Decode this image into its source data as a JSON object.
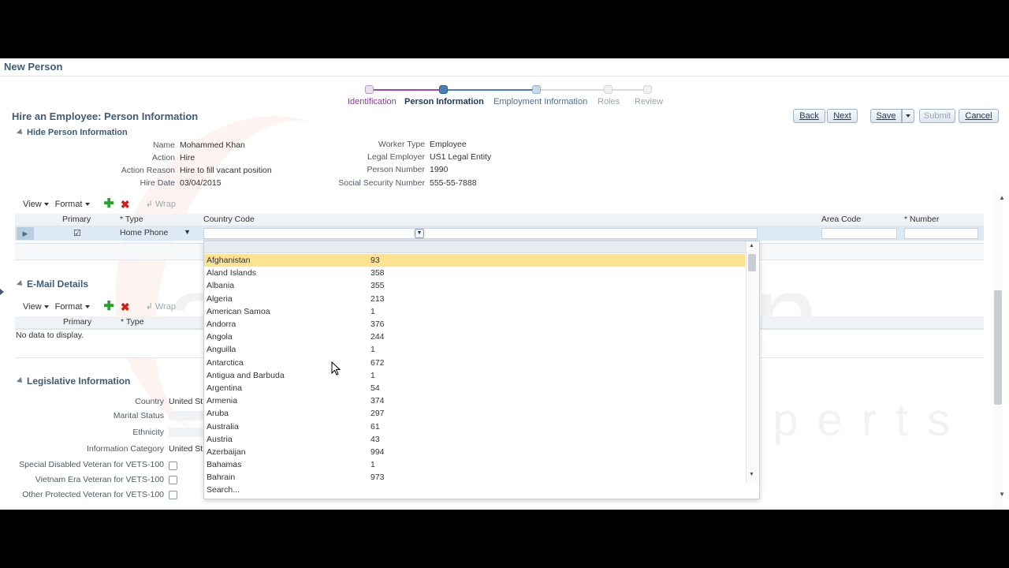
{
  "page": {
    "title": "New Person"
  },
  "train": [
    {
      "label": "Identification",
      "color": "#8a3d97",
      "node_bg": "#e8dff0",
      "node_border": "#b49ac8"
    },
    {
      "label": "Person Information",
      "color": "#203a5a",
      "node_bg": "#4a7fb5",
      "node_border": "#2e5f93"
    },
    {
      "label": "Employment Information",
      "color": "#4b6f93",
      "node_bg": "#c9d9ea",
      "node_border": "#8fb0d0"
    },
    {
      "label": "Roles",
      "color": "#9aa3ab",
      "node_bg": "#eef0f2",
      "node_border": "#d2d7dc"
    },
    {
      "label": "Review",
      "color": "#9aa3ab",
      "node_bg": "#eef0f2",
      "node_border": "#d2d7dc"
    }
  ],
  "header": {
    "title": "Hire an Employee: Person Information"
  },
  "buttons": {
    "back": "Back",
    "next": "Next",
    "save": "Save",
    "submit": "Submit",
    "cancel": "Cancel"
  },
  "person_info": {
    "toggle_label": "Hide Person Information",
    "left": [
      {
        "key": "Name",
        "value": "Mohammed Khan"
      },
      {
        "key": "Action",
        "value": "Hire"
      },
      {
        "key": "Action Reason",
        "value": "Hire to fill vacant position"
      },
      {
        "key": "Hire Date",
        "value": "03/04/2015"
      }
    ],
    "right": [
      {
        "key": "Worker Type",
        "value": "Employee"
      },
      {
        "key": "Legal Employer",
        "value": "US1 Legal Entity"
      },
      {
        "key": "Person Number",
        "value": "1990"
      },
      {
        "key": "Social Security Number",
        "value": "555-55-7888"
      }
    ]
  },
  "toolbar": {
    "view": "View",
    "format": "Format",
    "wrap": "Wrap"
  },
  "phone_grid": {
    "col_primary": "Primary",
    "col_type": "* Type",
    "col_country_code": "Country Code",
    "col_area_code": "Area Code",
    "col_number": "* Number",
    "row_type_value": "Home Phone"
  },
  "email": {
    "title": "E-Mail Details",
    "col_primary": "Primary",
    "col_type": "* Type",
    "empty_text": "No data to display."
  },
  "legislative": {
    "title": "Legislative Information",
    "fields": [
      {
        "key": "Country",
        "value": "United St"
      },
      {
        "key": "Marital Status",
        "value": ""
      },
      {
        "key": "Ethnicity",
        "value": ""
      },
      {
        "key": "Information Category",
        "value": "United St"
      }
    ],
    "checkboxes": [
      "Special Disabled Veteran for VETS-100",
      "Vietnam Era Veteran for VETS-100",
      "Other Protected Veteran for VETS-100"
    ]
  },
  "country_dropdown": {
    "items": [
      {
        "name": "Afghanistan",
        "code": "93"
      },
      {
        "name": "Aland Islands",
        "code": "358"
      },
      {
        "name": "Albania",
        "code": "355"
      },
      {
        "name": "Algeria",
        "code": "213"
      },
      {
        "name": "American Samoa",
        "code": "1"
      },
      {
        "name": "Andorra",
        "code": "376"
      },
      {
        "name": "Angola",
        "code": "244"
      },
      {
        "name": "Anguilla",
        "code": "1"
      },
      {
        "name": "Antarctica",
        "code": "672"
      },
      {
        "name": "Antigua and Barbuda",
        "code": "1"
      },
      {
        "name": "Argentina",
        "code": "54"
      },
      {
        "name": "Armenia",
        "code": "374"
      },
      {
        "name": "Aruba",
        "code": "297"
      },
      {
        "name": "Australia",
        "code": "61"
      },
      {
        "name": "Austria",
        "code": "43"
      },
      {
        "name": "Azerbaijan",
        "code": "994"
      },
      {
        "name": "Bahamas",
        "code": "1"
      },
      {
        "name": "Bahrain",
        "code": "973"
      }
    ],
    "selected_index": 0,
    "search_label": "Search..."
  },
  "watermark": {
    "line1": "apps2fusion",
    "line2": "Training Experts"
  },
  "icons": {
    "plus": "plus-icon",
    "delete": "delete-icon",
    "wrap": "wrap-icon",
    "expand": "expand-icon",
    "checkbox": "checkbox-icon",
    "dropdown": "chevron-down-icon",
    "cursor": "mouse-cursor-icon"
  },
  "colors": {
    "accent": "#3e5b77",
    "selection": "#fde38f",
    "add_green": "#2aa12a",
    "delete_red": "#d0201a"
  }
}
